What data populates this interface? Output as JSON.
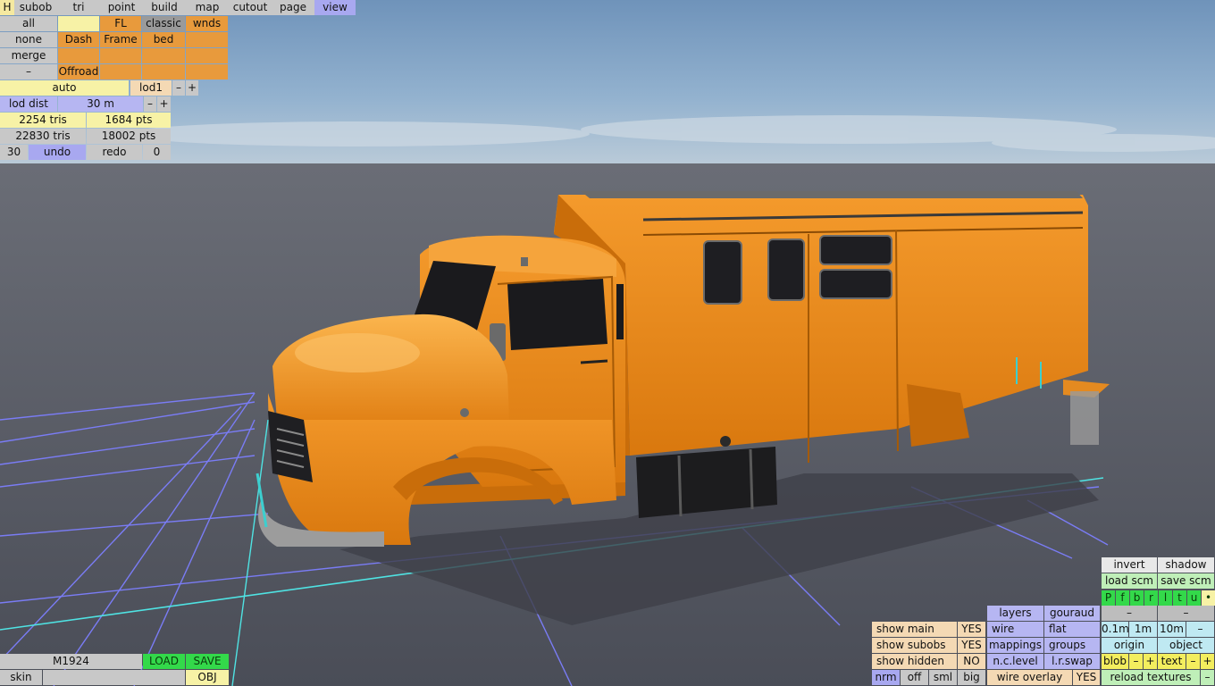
{
  "top_menu": {
    "h": "H",
    "items": [
      "subob",
      "tri",
      "point",
      "build",
      "map",
      "cutout",
      "page",
      "view"
    ]
  },
  "subob_grid": {
    "all": "all",
    "none": "none",
    "merge": "merge",
    "minus": "–",
    "fl": "FL",
    "classic": "classic",
    "wnds": "wnds",
    "dash": "Dash",
    "frame": "Frame",
    "bed": "bed",
    "offroad": "Offroad"
  },
  "lod": {
    "auto": "auto",
    "level": "lod1",
    "dec": "–",
    "inc": "+",
    "dist_label": "lod dist",
    "dist_value": "30 m",
    "dist_dec": "–",
    "dist_inc": "+"
  },
  "stats": {
    "lod_tris": "2254 tris",
    "lod_pts": "1684 pts",
    "total_tris": "22830 tris",
    "total_pts": "18002 pts"
  },
  "history": {
    "count": "30",
    "undo": "undo",
    "redo": "redo",
    "redo_count": "0"
  },
  "file": {
    "model_name": "M1924",
    "load": "LOAD",
    "save": "SAVE",
    "skin": "skin",
    "skin_value": "",
    "obj": "OBJ"
  },
  "view_panel": {
    "invert": "invert",
    "shadow": "shadow",
    "load_scm": "load scm",
    "save_scm": "save scm",
    "p_letters": [
      "P",
      "f",
      "b",
      "r",
      "l",
      "t",
      "u",
      "•"
    ],
    "dec1": "–",
    "dec2": "–",
    "layers": "layers",
    "gouraud": "gouraud",
    "show_main": "show main",
    "show_main_val": "YES",
    "wire": "wire",
    "flat": "flat",
    "grid_01": "0.1m",
    "grid_1": "1m",
    "grid_10": "10m",
    "grid_minus": "–",
    "show_subobs": "show subobs",
    "show_subobs_val": "YES",
    "mappings": "mappings",
    "groups": "groups",
    "origin": "origin",
    "object": "object",
    "show_hidden": "show hidden",
    "show_hidden_val": "NO",
    "nc_level": "n.c.level",
    "lr_swap": "l.r.swap",
    "blob": "blob",
    "blob_dec": "–",
    "blob_inc": "+",
    "text": "text",
    "text_dec": "–",
    "text_inc": "+",
    "nrm": "nrm",
    "off": "off",
    "sml": "sml",
    "big": "big",
    "wire_overlay": "wire overlay",
    "wire_overlay_val": "YES",
    "reload_textures": "reload textures",
    "reload_minus": "–"
  }
}
